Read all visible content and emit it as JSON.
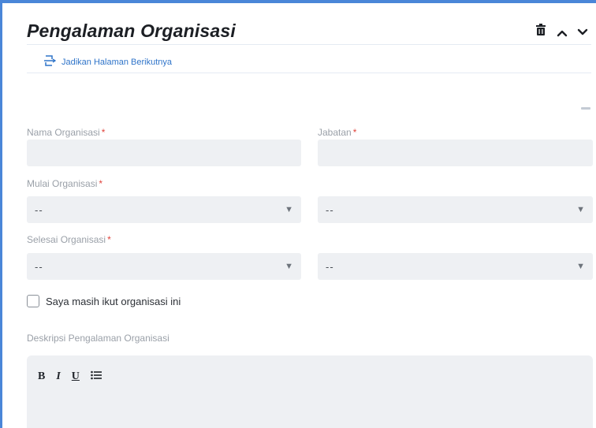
{
  "section": {
    "title": "Pengalaman Organisasi",
    "page_link_label": "Jadikan Halaman Berikutnya"
  },
  "fields": {
    "nama_organisasi": {
      "label": "Nama Organisasi",
      "required_mark": "*",
      "value": ""
    },
    "jabatan": {
      "label": "Jabatan",
      "required_mark": "*",
      "value": ""
    },
    "mulai": {
      "label": "Mulai Organisasi",
      "required_mark": "*",
      "month": "--",
      "year": "--"
    },
    "selesai": {
      "label": "Selesai Organisasi",
      "required_mark": "*",
      "month": "--",
      "year": "--"
    },
    "masih_ikut": {
      "label": "Saya masih ikut organisasi ini",
      "checked": false
    },
    "deskripsi": {
      "label": "Deskripsi Pengalaman Organisasi"
    }
  },
  "editor_toolbar": {
    "bold": "B",
    "italic": "I",
    "underline": "U"
  },
  "icons": {
    "delete": "trash-icon",
    "collapse": "chevron-up-icon",
    "expand": "chevron-down-icon",
    "page": "page-break-icon",
    "list": "bullet-list-icon"
  },
  "colors": {
    "accent": "#4a86d8",
    "link": "#2f74c9",
    "required": "#e0453d",
    "field_bg": "#eef0f3"
  }
}
